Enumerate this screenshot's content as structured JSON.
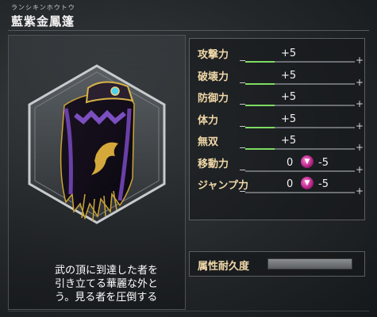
{
  "item": {
    "ruby": "ランシキンホウトウ",
    "name": "藍紫金鳳篷",
    "description": "武の頂に到達した者を\n引き立てる華麗な外と\nう。見る者を圧倒する"
  },
  "stats": [
    {
      "label": "攻撃力",
      "value": "+5",
      "fill": 0.27
    },
    {
      "label": "破壊力",
      "value": "+5",
      "fill": 0.27
    },
    {
      "label": "防御力",
      "value": "+5",
      "fill": 0.27
    },
    {
      "label": "体力",
      "value": "+5",
      "fill": 0.27
    },
    {
      "label": "無双",
      "value": "+5",
      "fill": 0.27
    },
    {
      "label": "移動力",
      "base": "0",
      "delta": "-5",
      "icon": "down-arrow-icon",
      "fill": 0.0
    },
    {
      "label": "ジャンプ力",
      "base": "0",
      "delta": "-5",
      "icon": "down-arrow-icon",
      "fill": 0.0
    }
  ],
  "durability": {
    "label": "属性耐久度",
    "fill": 1.0
  },
  "colors": {
    "stat_fill": "#7edc62",
    "label": "#f0d8a8",
    "arrow": "#d0309a"
  }
}
